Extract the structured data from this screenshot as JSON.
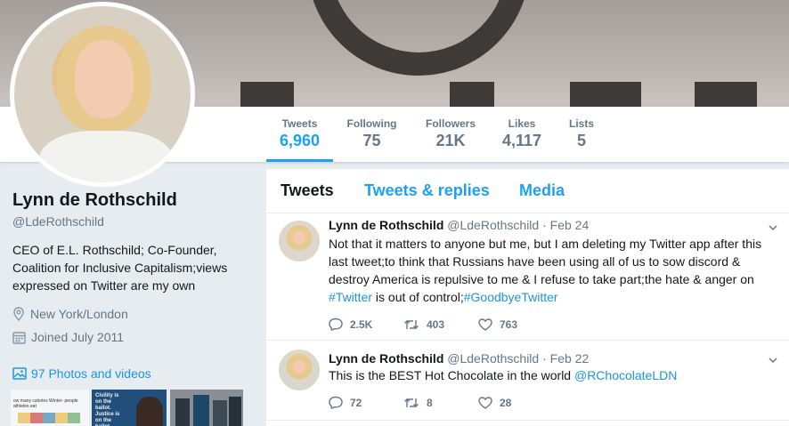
{
  "profile": {
    "name": "Lynn de Rothschild",
    "handle": "@LdeRothschild",
    "bio": "CEO of E.L. Rothschild; Co-Founder, Coalition for Inclusive Capitalism;views expressed on Twitter are my own",
    "location": "New York/London",
    "joined": "Joined July 2011",
    "photos_link": "97 Photos and videos"
  },
  "stats": [
    {
      "label": "Tweets",
      "value": "6,960"
    },
    {
      "label": "Following",
      "value": "75"
    },
    {
      "label": "Followers",
      "value": "21K"
    },
    {
      "label": "Likes",
      "value": "4,117"
    },
    {
      "label": "Lists",
      "value": "5"
    }
  ],
  "tabs": {
    "tweets": "Tweets",
    "replies": "Tweets & replies",
    "media": "Media"
  },
  "tweets": [
    {
      "name": "Lynn de Rothschild",
      "handle": "@LdeRothschild",
      "date": "· Feb 24",
      "text_main": "Not that it matters to anyone but me, but I am deleting my Twitter app after this last tweet;to think that Russians have been using all of us to sow discord & destroy America is repulsive to me & I refuse to take part;the hate & anger on ",
      "hashtag1": "#Twitter",
      "text_mid": " is out of control;",
      "hashtag2": "#GoodbyeTwitter",
      "replies": "2.5K",
      "retweets": "403",
      "likes": "763"
    },
    {
      "name": "Lynn de Rothschild",
      "handle": "@LdeRothschild",
      "date": "· Feb 22",
      "text_main": "This is the BEST Hot Chocolate in the world ",
      "mention": "@RChocolateLDN",
      "replies": "72",
      "retweets": "8",
      "likes": "28"
    }
  ],
  "thumbs": [
    {
      "text": "ow many calories Winter- people athletes eat"
    },
    {
      "text": "Civility is on the ballot. Justice is on the ballot."
    },
    {
      "text": ""
    }
  ],
  "colors": {
    "accent": "#1da1f2",
    "link": "#1b95e0",
    "muted": "#657786",
    "bg": "#e6ecf0"
  }
}
